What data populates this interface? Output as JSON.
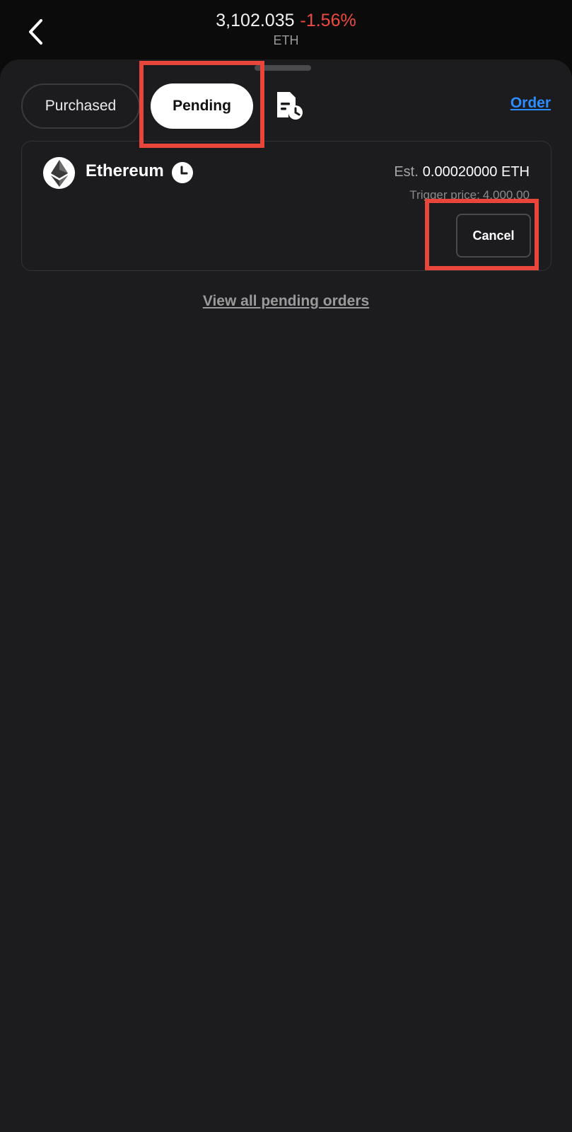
{
  "header": {
    "price": "3,102.035",
    "change": "-1.56%",
    "symbol": "ETH"
  },
  "tabs": {
    "purchased_label": "Purchased",
    "pending_label": "Pending",
    "selected": "Pending"
  },
  "order_link_label": "Order",
  "pending_order": {
    "asset_name": "Ethereum",
    "est_label": "Est.",
    "est_amount": "0.00020000 ETH",
    "trigger_label": "Trigger price:",
    "trigger_value": "4,000.00",
    "cancel_label": "Cancel"
  },
  "view_all_label": "View all pending orders",
  "colors": {
    "accent_link": "#2d8cff",
    "negative_change": "#ef4a3f",
    "highlight_box": "#e8463a",
    "background": "#1c1c1f"
  },
  "icons": {
    "back": "chevron-left-icon",
    "document_clock": "document-clock-icon",
    "asset_logo": "ethereum-logo",
    "status": "clock-icon"
  }
}
